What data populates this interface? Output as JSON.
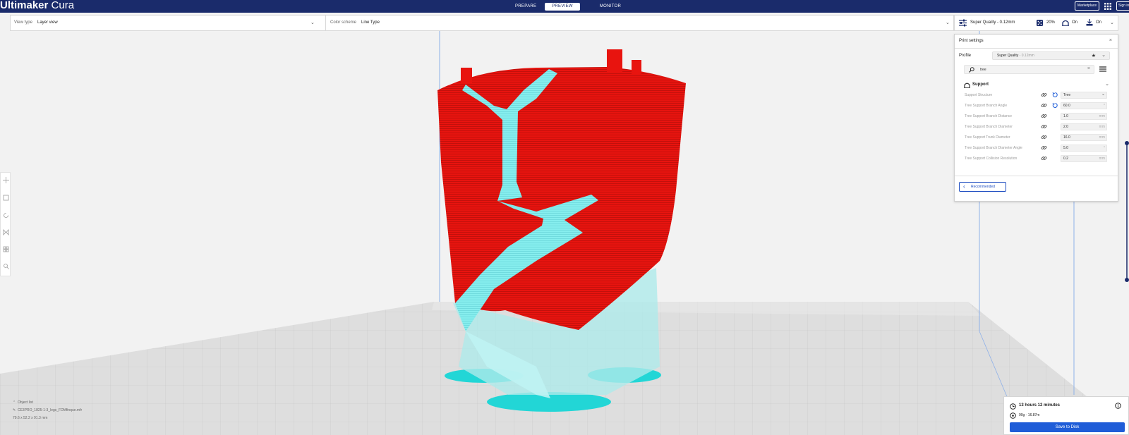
{
  "app": {
    "logo_bold": "Ultimaker",
    "logo_light": "Cura"
  },
  "stages": {
    "prepare": "PREPARE",
    "preview": "PREVIEW",
    "monitor": "MONITOR"
  },
  "header": {
    "marketplace": "Marketplace",
    "signin": "Sign in"
  },
  "view_bar": {
    "view_type_label": "View type",
    "view_type_value": "Layer view",
    "color_scheme_label": "Color scheme",
    "color_scheme_value": "Line Type"
  },
  "quick_settings": {
    "profile": "Super Quality - 0.12mm",
    "infill": "20%",
    "support": "On",
    "adhesion": "On"
  },
  "print_settings": {
    "title": "Print settings",
    "profile_label": "Profile",
    "profile_name": "Super Quality",
    "profile_detail": " - 0.12mm",
    "search_value": "tree",
    "section": "Support",
    "settings": [
      {
        "name": "Support Structure",
        "value": "Tree",
        "unit": "",
        "dropdown": true,
        "reset": true
      },
      {
        "name": "Tree Support Branch Angle",
        "value": "60.0",
        "unit": "°",
        "dropdown": false,
        "reset": true
      },
      {
        "name": "Tree Support Branch Distance",
        "value": "1.0",
        "unit": "mm",
        "dropdown": false,
        "reset": false
      },
      {
        "name": "Tree Support Branch Diameter",
        "value": "2.0",
        "unit": "mm",
        "dropdown": false,
        "reset": false
      },
      {
        "name": "Tree Support Trunk Diameter",
        "value": "16.0",
        "unit": "mm",
        "dropdown": false,
        "reset": false
      },
      {
        "name": "Tree Support Branch Diameter Angle",
        "value": "5.0",
        "unit": "°",
        "dropdown": false,
        "reset": false
      },
      {
        "name": "Tree Support Collision Resolution",
        "value": "0.2",
        "unit": "mm",
        "dropdown": false,
        "reset": false
      }
    ],
    "recommended_button": "Recommended"
  },
  "object_info": {
    "objects_toggle": "Object list",
    "filename": "CE3PRO_1825-1-3_legs_FDMfinque.mfr",
    "dimensions": "79.6 x 52.2 x 91.3 mm"
  },
  "job": {
    "time": "13 hours 12 minutes",
    "material": "90g · 16.87m",
    "save_button": "Save to Disk"
  },
  "colors": {
    "topbar": "#1a2b6b",
    "accent": "#1f5dd8",
    "model_wall": "#e8140f",
    "support": "#7ff0f0",
    "bed": "#d8d8d8"
  }
}
